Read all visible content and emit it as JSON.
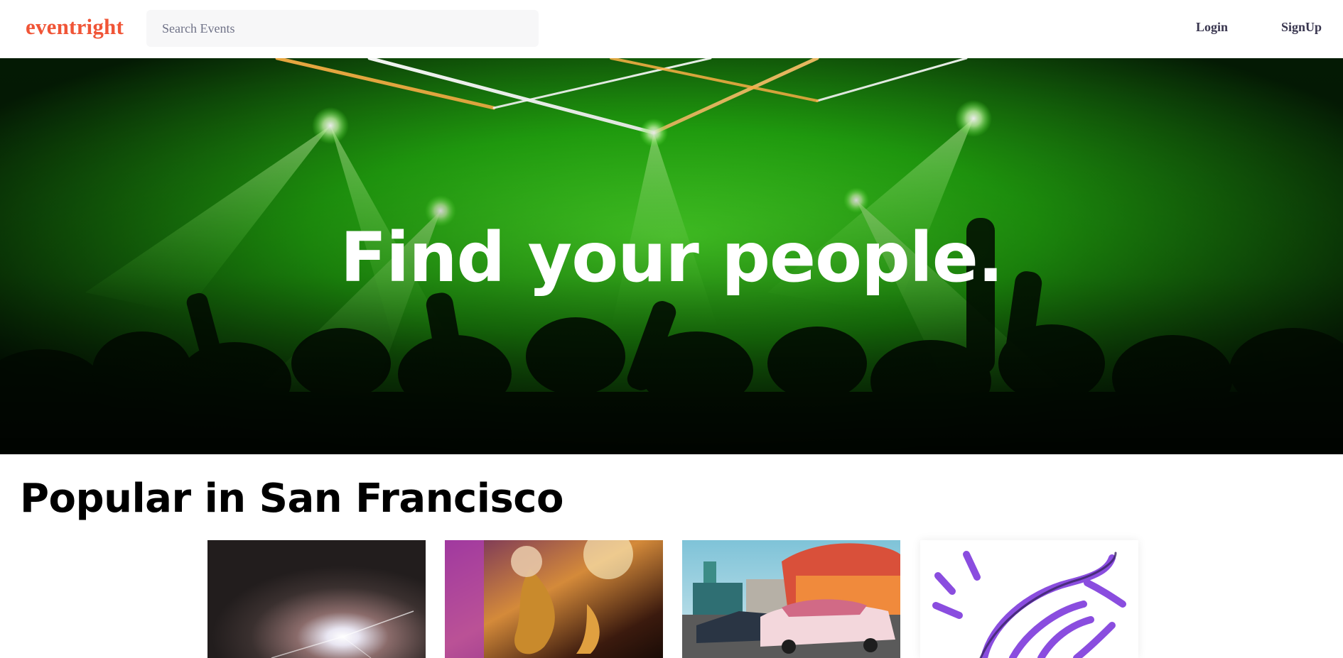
{
  "header": {
    "logo": "eventright",
    "search_placeholder": "Search Events",
    "login_label": "Login",
    "signup_label": "SignUp"
  },
  "hero": {
    "title": "Find your people.",
    "image": "concert-crowd-green-lasers"
  },
  "popular": {
    "title": "Popular in San Francisco",
    "cards": [
      {
        "image": "concert-spotlight"
      },
      {
        "image": "saxophone-band"
      },
      {
        "image": "retro-diner-cars"
      },
      {
        "image": "purple-illustration"
      }
    ]
  },
  "colors": {
    "brand": "#f05537",
    "nav_text": "#39364f",
    "search_bg": "#f7f7f8",
    "hero_green": "#3bd41a",
    "illustration_purple": "#8a4ddf"
  }
}
